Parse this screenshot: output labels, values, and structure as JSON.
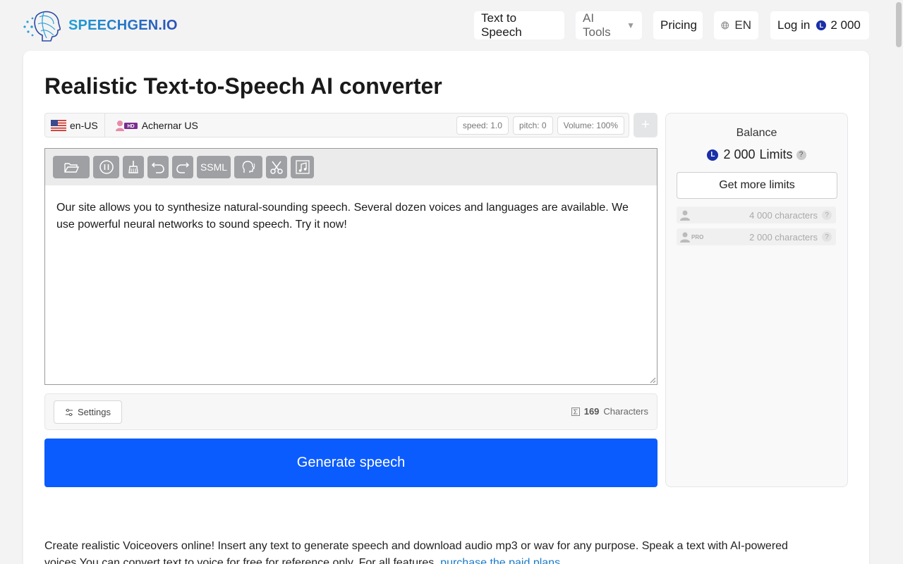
{
  "header": {
    "logo_text": "SPEECHGEN.IO",
    "nav": {
      "text_to_speech": "Text to Speech",
      "ai_tools": "AI Tools",
      "pricing": "Pricing",
      "language": "EN",
      "login": "Log in",
      "balance": "2 000",
      "coin_letter": "L"
    }
  },
  "main": {
    "title": "Realistic Text-to-Speech AI converter",
    "voice_bar": {
      "locale": "en-US",
      "hd_badge": "HD",
      "voice_name": "Achernar US",
      "speed": "speed: 1.0",
      "pitch": "pitch: 0",
      "volume": "Volume: 100%",
      "add_label": "+"
    },
    "toolbar": {
      "ssml_label": "SSML",
      "icons": [
        "folder-open-icon",
        "pause-icon",
        "brush-clean-icon",
        "undo-icon",
        "redo-icon",
        "ssml",
        "head-voice-icon",
        "scissors-icon",
        "music-note-icon"
      ]
    },
    "editor_text": "Our site allows you to synthesize natural-sounding speech. Several dozen voices and languages are available. We use powerful neural networks to sound speech. Try it now!",
    "status": {
      "settings_label": "Settings",
      "char_count": "169",
      "char_label": "Characters"
    },
    "generate_label": "Generate speech"
  },
  "balance_panel": {
    "title": "Balance",
    "coin_letter": "L",
    "amount": "2 000",
    "unit": "Limits",
    "help": "?",
    "more_limits_label": "Get more limits",
    "tiers": [
      {
        "badge": "",
        "text": "4 000 characters",
        "help": "?"
      },
      {
        "badge": "PRO",
        "text": "2 000 characters",
        "help": "?"
      }
    ]
  },
  "description": {
    "text": "Create realistic Voiceovers online! Insert any text to generate speech and download audio mp3 or wav for any purpose. Speak a text with AI-powered voices.You can convert text to voice for free for reference only. For all features, ",
    "link_text": "purchase the paid plans",
    "tail": "."
  },
  "colors": {
    "accent": "#0b5cff",
    "coin": "#1a2fa8",
    "toolbar_button": "#9ea0a3",
    "link": "#1a7ac9"
  }
}
